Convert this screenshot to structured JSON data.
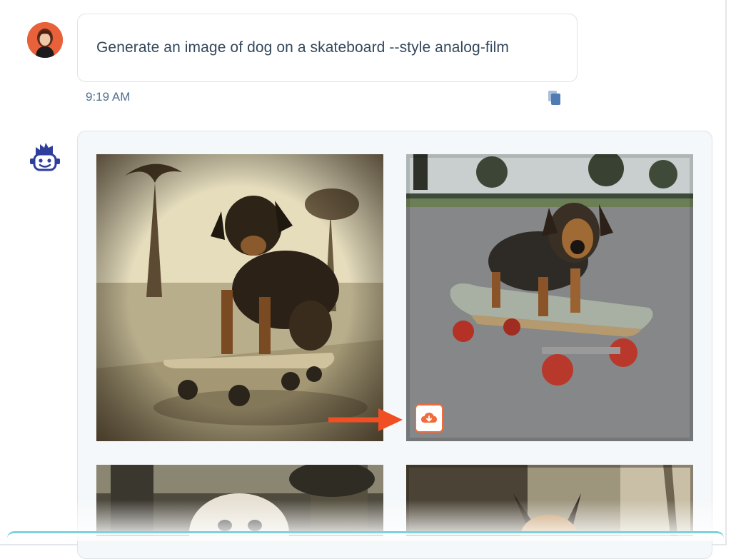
{
  "user_message": {
    "text": "Generate an image of dog on a skateboard --style analog-film",
    "timestamp": "9:19 AM",
    "avatar_icon": "user-avatar-icon",
    "copy_icon": "copy-icon"
  },
  "bot_message": {
    "avatar_icon": "bot-avatar-icon",
    "images": [
      {
        "description_name": "generated-image-1"
      },
      {
        "description_name": "generated-image-2"
      },
      {
        "description_name": "generated-image-3"
      },
      {
        "description_name": "generated-image-4"
      }
    ],
    "download_icon": "cloud-download-icon",
    "accent_color": "#f26b3a"
  },
  "colors": {
    "text": "#33475b",
    "timestamp": "#516f90",
    "bubble_border": "#dfe3e8",
    "bot_bubble_bg": "#f5f8fa",
    "arrow": "#f04e23",
    "bottom_bar": "#7fd1de"
  }
}
